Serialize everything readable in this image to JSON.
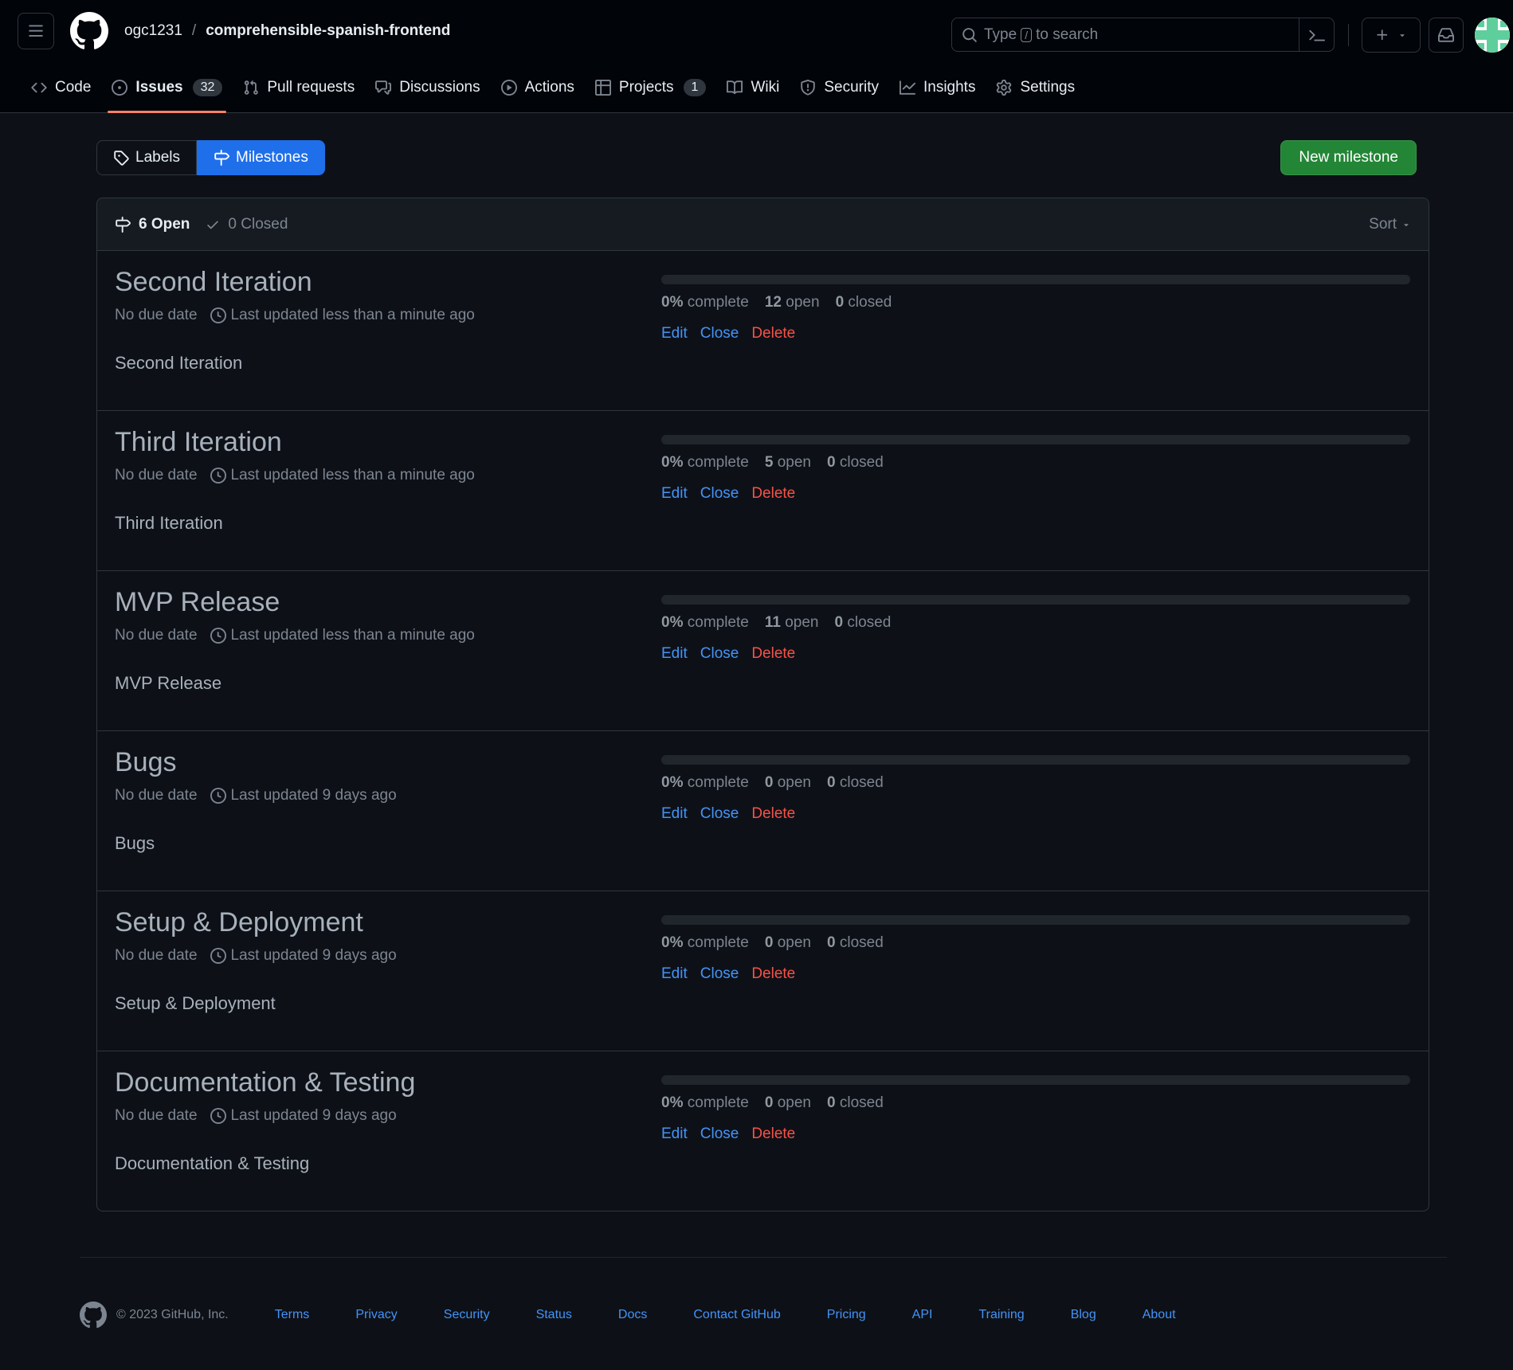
{
  "header": {
    "owner": "ogc1231",
    "separator": "/",
    "repo": "comprehensible-spanish-frontend",
    "search": {
      "prefix": "Type",
      "key": "/",
      "suffix": "to search"
    }
  },
  "nav": {
    "tabs": [
      {
        "label": "Code"
      },
      {
        "label": "Issues",
        "count": "32"
      },
      {
        "label": "Pull requests"
      },
      {
        "label": "Discussions"
      },
      {
        "label": "Actions"
      },
      {
        "label": "Projects",
        "count": "1"
      },
      {
        "label": "Wiki"
      },
      {
        "label": "Security"
      },
      {
        "label": "Insights"
      },
      {
        "label": "Settings"
      }
    ]
  },
  "subnav": {
    "labels": "Labels",
    "milestones": "Milestones",
    "new_button": "New milestone"
  },
  "filter": {
    "open": "6 Open",
    "closed": "0 Closed",
    "sort": "Sort"
  },
  "milestones": [
    {
      "title": "Second Iteration",
      "due": "No due date",
      "updated": "Last updated less than a minute ago",
      "description": "Second Iteration",
      "percent": "0%",
      "percent_label": "complete",
      "open": "12",
      "open_label": "open",
      "closed": "0",
      "closed_label": "closed",
      "progress": 0,
      "edit": "Edit",
      "close": "Close",
      "delete": "Delete"
    },
    {
      "title": "Third Iteration",
      "due": "No due date",
      "updated": "Last updated less than a minute ago",
      "description": "Third Iteration",
      "percent": "0%",
      "percent_label": "complete",
      "open": "5",
      "open_label": "open",
      "closed": "0",
      "closed_label": "closed",
      "progress": 0,
      "edit": "Edit",
      "close": "Close",
      "delete": "Delete"
    },
    {
      "title": "MVP Release",
      "due": "No due date",
      "updated": "Last updated less than a minute ago",
      "description": "MVP Release",
      "percent": "0%",
      "percent_label": "complete",
      "open": "11",
      "open_label": "open",
      "closed": "0",
      "closed_label": "closed",
      "progress": 0,
      "edit": "Edit",
      "close": "Close",
      "delete": "Delete"
    },
    {
      "title": "Bugs",
      "due": "No due date",
      "updated": "Last updated 9 days ago",
      "description": "Bugs",
      "percent": "0%",
      "percent_label": "complete",
      "open": "0",
      "open_label": "open",
      "closed": "0",
      "closed_label": "closed",
      "progress": 0,
      "edit": "Edit",
      "close": "Close",
      "delete": "Delete"
    },
    {
      "title": "Setup & Deployment",
      "due": "No due date",
      "updated": "Last updated 9 days ago",
      "description": "Setup & Deployment",
      "percent": "0%",
      "percent_label": "complete",
      "open": "0",
      "open_label": "open",
      "closed": "0",
      "closed_label": "closed",
      "progress": 0,
      "edit": "Edit",
      "close": "Close",
      "delete": "Delete"
    },
    {
      "title": "Documentation & Testing",
      "due": "No due date",
      "updated": "Last updated 9 days ago",
      "description": "Documentation & Testing",
      "percent": "0%",
      "percent_label": "complete",
      "open": "0",
      "open_label": "open",
      "closed": "0",
      "closed_label": "closed",
      "progress": 0,
      "edit": "Edit",
      "close": "Close",
      "delete": "Delete"
    }
  ],
  "footer": {
    "copyright": "© 2023 GitHub, Inc.",
    "links": [
      "Terms",
      "Privacy",
      "Security",
      "Status",
      "Docs",
      "Contact GitHub",
      "Pricing",
      "API",
      "Training",
      "Blog",
      "About"
    ]
  },
  "colors": {
    "background": "#0d1117",
    "header_bg": "#010409",
    "accent_blue": "#1f6feb",
    "link": "#4493f8",
    "danger": "#f85149",
    "primary_button": "#238636",
    "tab_underline": "#f78166"
  },
  "icons": {
    "menu": "hamburger-icon",
    "logo": "github-logo-icon",
    "search": "search-icon",
    "command": "command-palette-icon",
    "plus": "plus-icon",
    "inbox": "inbox-icon",
    "tag": "tag-icon",
    "milestone": "milestone-icon",
    "check": "check-icon",
    "clock": "clock-icon"
  }
}
